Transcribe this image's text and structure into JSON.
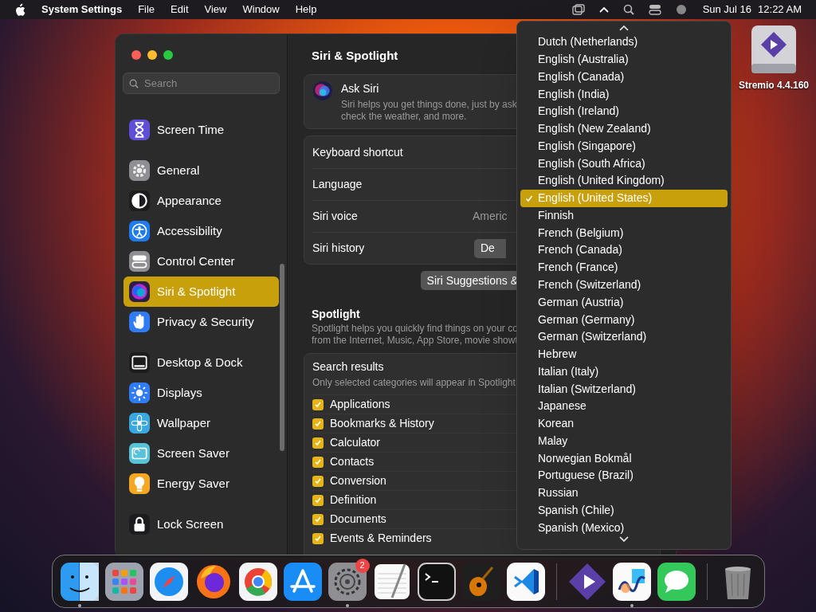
{
  "menu_bar": {
    "app": "System Settings",
    "menus": [
      "File",
      "Edit",
      "View",
      "Window",
      "Help"
    ],
    "date": "Sun Jul 16",
    "time": "12:22 AM"
  },
  "desktop": {
    "drive_label": "Stremio 4.4.160"
  },
  "window": {
    "search": {
      "placeholder": "Search"
    },
    "sidebar": {
      "groups": [
        [
          {
            "label": "Screen Time",
            "color": "#5e4fd6",
            "selected": false
          }
        ],
        [
          {
            "label": "General",
            "color": "#8e8e93",
            "selected": false
          },
          {
            "label": "Appearance",
            "color": "#1c1c1e",
            "selected": false
          },
          {
            "label": "Accessibility",
            "color": "#1e7cf2",
            "selected": false
          },
          {
            "label": "Control Center",
            "color": "#8e8e93",
            "selected": false
          },
          {
            "label": "Siri & Spotlight",
            "color": "#2a1f4a",
            "selected": true
          },
          {
            "label": "Privacy & Security",
            "color": "#2f7cf6",
            "selected": false
          }
        ],
        [
          {
            "label": "Desktop & Dock",
            "color": "#1c1c1e",
            "selected": false
          },
          {
            "label": "Displays",
            "color": "#2f7cf6",
            "selected": false
          },
          {
            "label": "Wallpaper",
            "color": "#39a8e0",
            "selected": false
          },
          {
            "label": "Screen Saver",
            "color": "#58c3d8",
            "selected": false
          },
          {
            "label": "Energy Saver",
            "color": "#f5a623",
            "selected": false
          }
        ],
        [
          {
            "label": "Lock Screen",
            "color": "#1c1c1e",
            "selected": false
          }
        ]
      ]
    },
    "title": "Siri & Spotlight",
    "ask_siri": {
      "title": "Ask Siri",
      "description": "Siri helps you get things done, just by ask\ncheck the weather, and more."
    },
    "siri_rows": [
      {
        "label": "Keyboard shortcut"
      },
      {
        "label": "Language"
      },
      {
        "label": "Siri voice",
        "value": "Americ"
      },
      {
        "label": "Siri history",
        "button": "De"
      }
    ],
    "suggestions_button": "Siri Suggestions &",
    "spotlight": {
      "title": "Spotlight",
      "description": "Spotlight helps you quickly find things on your co\nfrom the Internet, Music, App Store, movie showt"
    },
    "search_results": {
      "title": "Search results",
      "description": "Only selected categories will appear in Spotlight",
      "items": [
        {
          "label": "Applications",
          "checked": true
        },
        {
          "label": "Bookmarks & History",
          "checked": true
        },
        {
          "label": "Calculator",
          "checked": true
        },
        {
          "label": "Contacts",
          "checked": true
        },
        {
          "label": "Conversion",
          "checked": true
        },
        {
          "label": "Definition",
          "checked": true
        },
        {
          "label": "Documents",
          "checked": true
        },
        {
          "label": "Events & Reminders",
          "checked": true
        }
      ]
    }
  },
  "language_menu": {
    "items": [
      {
        "label": "Dutch (Netherlands)",
        "selected": false
      },
      {
        "label": "English (Australia)",
        "selected": false
      },
      {
        "label": "English (Canada)",
        "selected": false
      },
      {
        "label": "English (India)",
        "selected": false
      },
      {
        "label": "English (Ireland)",
        "selected": false
      },
      {
        "label": "English (New Zealand)",
        "selected": false
      },
      {
        "label": "English (Singapore)",
        "selected": false
      },
      {
        "label": "English (South Africa)",
        "selected": false
      },
      {
        "label": "English (United Kingdom)",
        "selected": false
      },
      {
        "label": "English (United States)",
        "selected": true
      },
      {
        "label": "Finnish",
        "selected": false
      },
      {
        "label": "French (Belgium)",
        "selected": false
      },
      {
        "label": "French (Canada)",
        "selected": false
      },
      {
        "label": "French (France)",
        "selected": false
      },
      {
        "label": "French (Switzerland)",
        "selected": false
      },
      {
        "label": "German (Austria)",
        "selected": false
      },
      {
        "label": "German (Germany)",
        "selected": false
      },
      {
        "label": "German (Switzerland)",
        "selected": false
      },
      {
        "label": "Hebrew",
        "selected": false
      },
      {
        "label": "Italian (Italy)",
        "selected": false
      },
      {
        "label": "Italian (Switzerland)",
        "selected": false
      },
      {
        "label": "Japanese",
        "selected": false
      },
      {
        "label": "Korean",
        "selected": false
      },
      {
        "label": "Malay",
        "selected": false
      },
      {
        "label": "Norwegian Bokmål",
        "selected": false
      },
      {
        "label": "Portuguese (Brazil)",
        "selected": false
      },
      {
        "label": "Russian",
        "selected": false
      },
      {
        "label": "Spanish (Chile)",
        "selected": false
      },
      {
        "label": "Spanish (Mexico)",
        "selected": false
      }
    ]
  },
  "dock": {
    "groups": [
      [
        {
          "running": true
        },
        {
          "running": false
        },
        {
          "running": false
        },
        {
          "running": false
        },
        {
          "running": false
        },
        {
          "running": false
        },
        {
          "running": true,
          "badge": "2"
        },
        {
          "running": false
        },
        {
          "running": false
        },
        {
          "running": false
        },
        {
          "running": false
        }
      ],
      [
        {
          "running": false
        },
        {
          "running": true
        },
        {
          "running": false
        }
      ],
      [
        {
          "running": false
        }
      ]
    ]
  }
}
